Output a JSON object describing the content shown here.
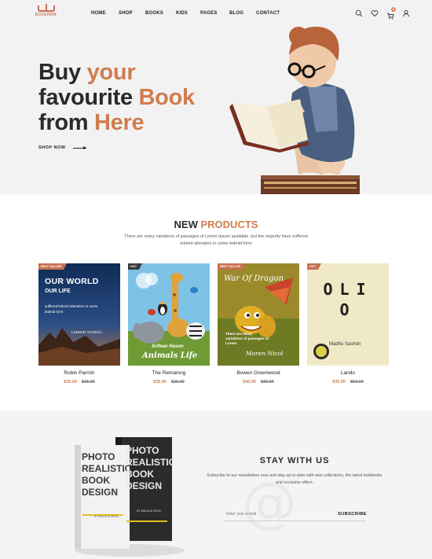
{
  "brand": {
    "name": "DOIGHOR"
  },
  "nav": {
    "items": [
      "HOME",
      "SHOP",
      "BOOKS",
      "KIDS",
      "PAGES",
      "BLOG",
      "CONTACT"
    ]
  },
  "header": {
    "cart_count": "0"
  },
  "hero": {
    "line1_a": "Buy ",
    "line1_b": "your",
    "line2_a": "favourite ",
    "line2_b": "Book",
    "line3_a": "from ",
    "line3_b": "Here",
    "cta": "SHOP NOW"
  },
  "products": {
    "title_a": "NEW ",
    "title_b": "PRODUCTS",
    "subtitle": "There are many variations of passages of Lorem Ipsum available, but the majority have suffered lebmid alteration in some ledmid form",
    "items": [
      {
        "tag": "BEST SALLER",
        "name": "Robin Parrish",
        "price": "$35.00",
        "old_price": "$35.00",
        "cover_title": "OUR WORLD",
        "cover_subtitle": "OUR LIFE",
        "cover_text": "suffered lebmid alteration in some ledmid form",
        "cover_author": "LEBMID NOIESA"
      },
      {
        "tag": "HOT",
        "name": "The Remainng",
        "price": "$35.00",
        "old_price": "$35.00",
        "cover_title": "Animals Life",
        "cover_author": "Arifean Hason"
      },
      {
        "tag": "BEST SALLER",
        "name": "Bowen Greenwood",
        "price": "$40.00",
        "old_price": "$35.00",
        "cover_title": "War Of Dragon",
        "cover_text": "There are many variations of passages of Lorem.",
        "cover_author": "Moren Nicol"
      },
      {
        "tag": "HOT",
        "name": "Lando",
        "price": "$35.00",
        "old_price": "$50.00",
        "cover_title": "OLIO",
        "cover_author": "Madhu Sashon"
      }
    ]
  },
  "newsletter": {
    "title": "STAY WITH US",
    "subtitle": "Subscribe to our newsletters now and stay up-to-date with new collections, the latest lookbooks and exclusive offers.",
    "email_placeholder": "Enter your e-mail",
    "button": "SUBSCRIBE",
    "mockup_title": "PHOTO REALISTIC BOOK DESIGN",
    "mockup_author": "BY MALSUD RESA"
  }
}
